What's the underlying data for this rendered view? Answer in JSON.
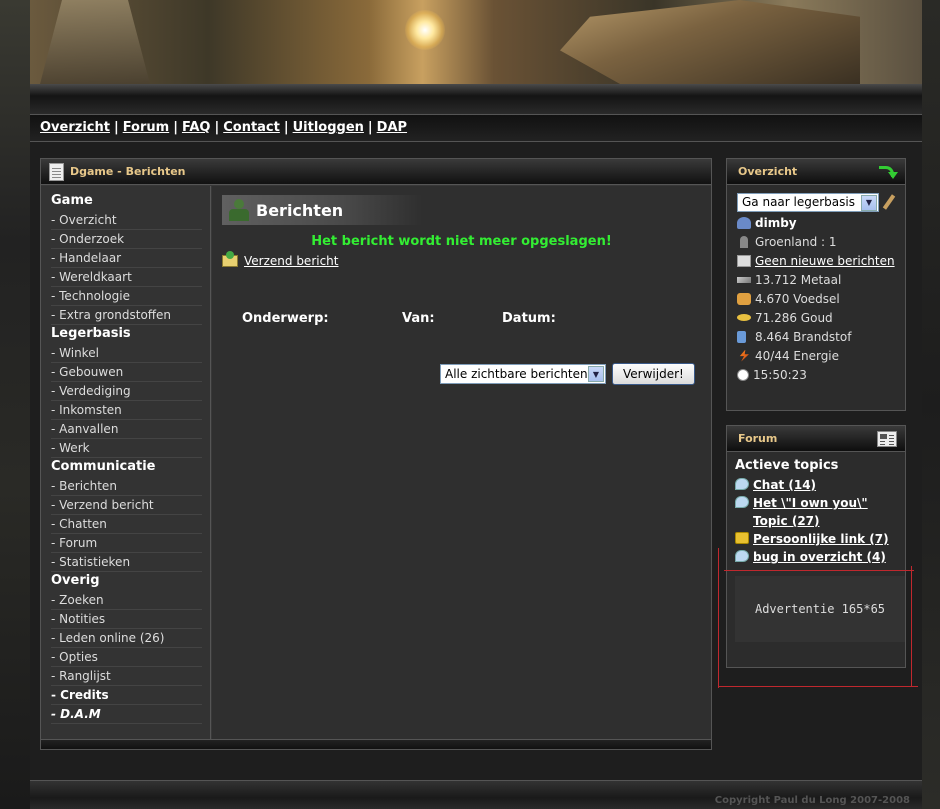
{
  "nav": {
    "items": [
      "Overzicht",
      "Forum",
      "FAQ",
      "Contact",
      "Uitloggen",
      "DAP"
    ],
    "separator": "|"
  },
  "main_panel": {
    "title": "Dgame - Berichten"
  },
  "menu": {
    "sections": [
      {
        "title": "Game",
        "items": [
          "- Overzicht",
          "- Onderzoek",
          "- Handelaar",
          "- Wereldkaart",
          "- Technologie",
          "- Extra grondstoffen"
        ]
      },
      {
        "title": "Legerbasis",
        "items": [
          "- Winkel",
          "- Gebouwen",
          "- Verdediging",
          "- Inkomsten",
          "- Aanvallen",
          "- Werk"
        ]
      },
      {
        "title": "Communicatie",
        "items": [
          "- Berichten",
          "- Verzend bericht",
          "- Chatten",
          "- Forum",
          "- Statistieken"
        ]
      },
      {
        "title": "Overig",
        "items": [
          "- Zoeken",
          "- Notities",
          "- Leden online (26)",
          "- Opties",
          "- Ranglijst",
          "- Credits",
          "- D.A.M"
        ]
      }
    ]
  },
  "content": {
    "title": "Berichten",
    "notice": "Het bericht wordt niet meer opgeslagen!",
    "send_link": "Verzend bericht",
    "columns": [
      "Onderwerp:",
      "Van:",
      "Datum:"
    ],
    "select_value": "Alle zichtbare berichten",
    "delete_button": "Verwijder!"
  },
  "overview": {
    "title": "Overzicht",
    "base_select": "Ga naar legerbasis",
    "username": "dimby",
    "location": "Groenland : 1",
    "messages": "Geen nieuwe berichten",
    "metal": "13.712 Metaal",
    "food": "4.670 Voedsel",
    "gold": "71.286 Goud",
    "fuel": "8.464 Brandstof",
    "energy": "40/44 Energie",
    "time": "15:50:23"
  },
  "forum": {
    "title": "Forum",
    "active_label": "Actieve topics",
    "topics": [
      {
        "text": "Chat (14)",
        "icon": "chat-bubble-icon"
      },
      {
        "text": "Het \\\"I own you\\\" Topic (27)",
        "icon": "chat-bubble-icon"
      },
      {
        "text": "Persoonlijke link (7)",
        "icon": "lock-icon"
      },
      {
        "text": "bug in overzicht (4)",
        "icon": "chat-bubble-icon"
      }
    ],
    "ad": "Advertentie 165*65"
  },
  "footer": {
    "copyright": "Copyright Paul du Long 2007-2008"
  },
  "colors": {
    "notice": "#33ee33",
    "panel_title": "#e8c88a",
    "ad_border": "#c0282e"
  }
}
